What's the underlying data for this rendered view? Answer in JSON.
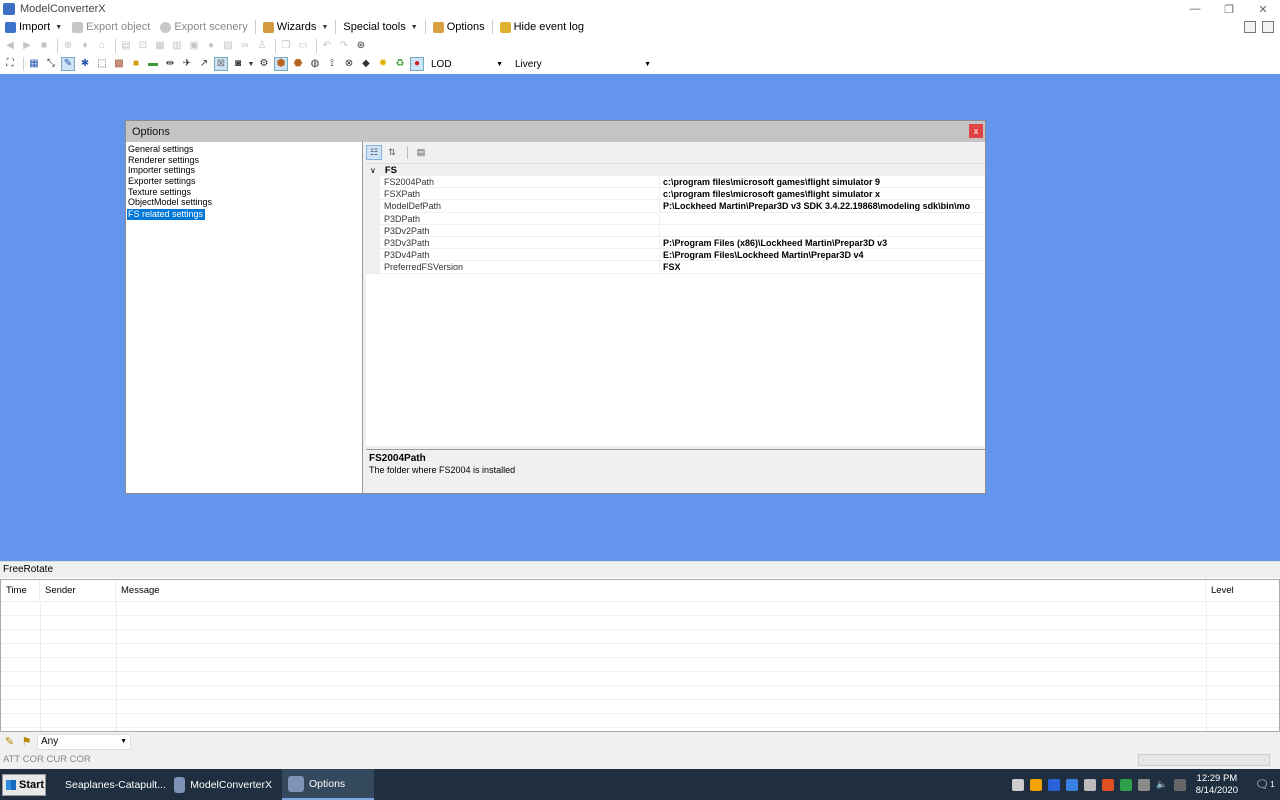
{
  "window": {
    "title": "ModelConverterX",
    "minimize_icon": "—",
    "restore_icon": "❐",
    "close_icon": "✕"
  },
  "menu": {
    "import": "Import",
    "export_object": "Export object",
    "export_scenery": "Export scenery",
    "wizards": "Wizards",
    "special_tools": "Special tools",
    "options": "Options",
    "hide_event_log": "Hide event log"
  },
  "toolbar": {
    "lod_label": "LOD",
    "livery_label": "Livery"
  },
  "dialog": {
    "title": "Options",
    "close_label": "x",
    "settings_list": [
      "General settings",
      "Renderer settings",
      "Importer settings",
      "Exporter settings",
      "Texture settings",
      "ObjectModel settings",
      "FS related settings"
    ],
    "selected_index": 6,
    "property_grid": {
      "category": "FS",
      "rows": [
        {
          "name": "FS2004Path",
          "value": "c:\\program files\\microsoft games\\flight simulator 9"
        },
        {
          "name": "FSXPath",
          "value": "c:\\program files\\microsoft games\\flight simulator x"
        },
        {
          "name": "ModelDefPath",
          "value": "P:\\Lockheed Martin\\Prepar3D v3 SDK 3.4.22.19868\\modeling sdk\\bin\\mo"
        },
        {
          "name": "P3DPath",
          "value": ""
        },
        {
          "name": "P3Dv2Path",
          "value": ""
        },
        {
          "name": "P3Dv3Path",
          "value": "P:\\Program Files (x86)\\Lockheed Martin\\Prepar3D v3"
        },
        {
          "name": "P3Dv4Path",
          "value": "E:\\Program Files\\Lockheed Martin\\Prepar3D v4"
        },
        {
          "name": "PreferredFSVersion",
          "value": "FSX"
        }
      ]
    },
    "description": {
      "title": "FS2004Path",
      "text": "The folder where FS2004 is installed"
    }
  },
  "mode_label": "FreeRotate",
  "event_log": {
    "columns": [
      "Time",
      "Sender",
      "Message",
      "Level"
    ],
    "filter_value": "Any"
  },
  "status": {
    "text": "ATT COR  CUR COR"
  },
  "taskbar": {
    "start": "Start",
    "tasks": [
      "Seaplanes-Catapult...",
      "ModelConverterX",
      "Options"
    ],
    "time": "12:29 PM",
    "date": "8/14/2020",
    "notification_count": "1"
  },
  "colors": {
    "workspace": "#6495ed",
    "selection": "#0078d7",
    "taskbar": "#1f2f3f"
  }
}
